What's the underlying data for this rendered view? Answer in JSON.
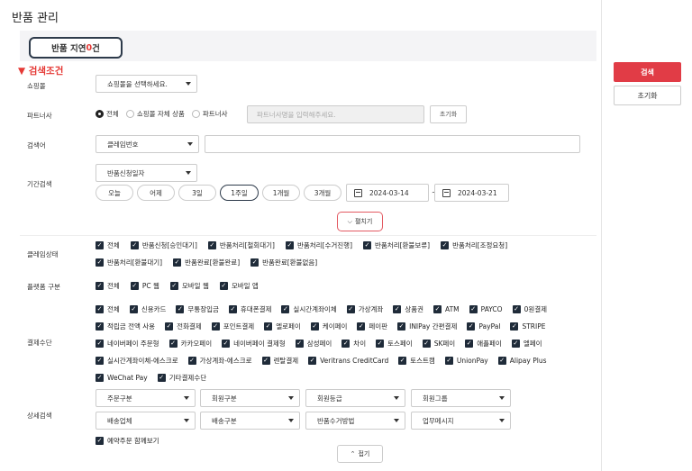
{
  "page_title": "반품 관리",
  "return_delay": {
    "prefix": "반품 지연 ",
    "count": "0",
    "suffix": "건"
  },
  "buttons": {
    "search": "검색",
    "reset": "초기화",
    "partner_reset": "초기화",
    "expand": "펼치기",
    "collapse": "접기"
  },
  "section_title": "▼ 검색조건",
  "labels": {
    "mall": "쇼핑몰",
    "partner": "파트너사",
    "search_word": "검색어",
    "period": "기간검색",
    "claim_status": "클레임상태",
    "platform": "플랫폼 구분",
    "payment": "결제수단",
    "detail": "상세검색"
  },
  "mall_select": "쇼핑몰을 선택하세요.",
  "partner_radios": [
    "전체",
    "쇼핑몰 자체 상품",
    "파트너사"
  ],
  "partner_placeholder": "파트너사명을 입력해주세요.",
  "search_select": "클레임번호",
  "search_input": "",
  "period_select": "반품신청일자",
  "period_pills": [
    "오늘",
    "어제",
    "3일",
    "1주일",
    "1개월",
    "3개월"
  ],
  "date_start": "2024-03-14",
  "date_sep": "~",
  "date_end": "2024-03-21",
  "claim_status": [
    "전체",
    "반품신청[승인대기]",
    "반품처리[철회대기]",
    "반품처리[수거진행]",
    "반품처리[환불보류]",
    "반품처리[조정요청]",
    "반품처리[환불대기]",
    "반품완료[환불완료]",
    "반품완료[환불없음]"
  ],
  "platforms": [
    "전체",
    "PC 웹",
    "모바일 웹",
    "모바일 앱"
  ],
  "payments": [
    [
      "전체",
      "신용카드",
      "무통장입금",
      "휴대폰결제",
      "실시간계좌이체",
      "가상계좌",
      "상품권",
      "ATM",
      "PAYCO",
      "0원결제"
    ],
    [
      "적립금 전액 사용",
      "전화결제",
      "포인트결제",
      "엘로페이",
      "케이페이",
      "페이판",
      "INIPay 간편결제",
      "PayPal",
      "STRIPE"
    ],
    [
      "네이버페이 주문형",
      "카카오페이",
      "네이버페이 결제형",
      "삼성페이",
      "차이",
      "토스페이",
      "SK페이",
      "애플페이",
      "엘페이"
    ],
    [
      "실시간계좌이체-에스크로",
      "가상계좌-에스크로",
      "렌탈결제",
      "Veritrans CreditCard",
      "토스트캠",
      "UnionPay",
      "Alipay Plus"
    ],
    [
      "WeChat Pay",
      "기타결제수단"
    ]
  ],
  "detail_selects": [
    [
      "주문구분",
      "회원구분",
      "회원등급",
      "회원그룹"
    ],
    [
      "배송업체",
      "배송구분",
      "반품수거방법",
      "업무메시지"
    ]
  ],
  "reserve_view": "예약주문 함께보기"
}
